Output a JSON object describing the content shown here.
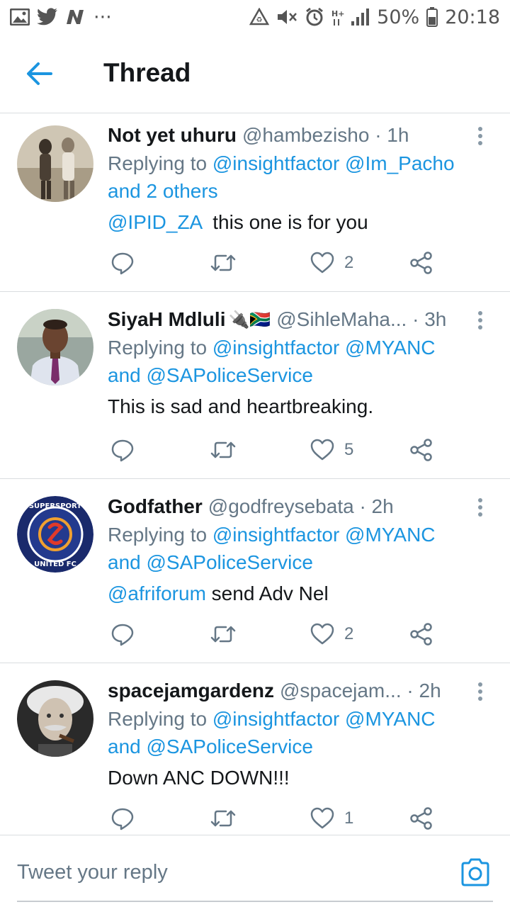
{
  "status_bar": {
    "battery": "50%",
    "time": "20:18",
    "network": "H+",
    "dots": "···"
  },
  "header": {
    "title": "Thread"
  },
  "tweets": [
    {
      "name": "Not yet uhuru",
      "handle": "@hambezisho",
      "time": "· 1h",
      "replying_prefix": "Replying to ",
      "replying_mentions": "@insightfactor @Im_Pacho",
      "replying_suffix": "and 2 others",
      "body_mention": "@IPID_ZA",
      "body_text": "  this one is for you",
      "likes": "2"
    },
    {
      "name": "SiyaH Mdluli",
      "name_emoji": "🔌🇿🇦",
      "handle": "@SihleMaha...",
      "time": "· 3h",
      "replying_prefix": "Replying to ",
      "replying_mentions": "@insightfactor @MYANC",
      "replying_suffix": "and @SAPoliceService",
      "body_mention": "",
      "body_text": "This is sad and heartbreaking.",
      "likes": "5"
    },
    {
      "name": "Godfather",
      "handle": "@godfreysebata",
      "time": "· 2h",
      "replying_prefix": "Replying to ",
      "replying_mentions": "@insightfactor @MYANC",
      "replying_suffix": "and @SAPoliceService",
      "body_mention": "@afriforum",
      "body_text": " send Adv Nel",
      "likes": "2",
      "avatar_text_top": "SUPERSPORT",
      "avatar_text_bottom": "UNITED FC"
    },
    {
      "name": "spacejamgardenz",
      "handle": "@spacejam...",
      "time": "· 2h",
      "replying_prefix": "Replying to ",
      "replying_mentions": "@insightfactor @MYANC",
      "replying_suffix": "and @SAPoliceService",
      "body_mention": "",
      "body_text": "Down ANC DOWN!!!",
      "likes": "1"
    }
  ],
  "reply_bar": {
    "placeholder": "Tweet your reply"
  },
  "colors": {
    "accent": "#1b95e0",
    "text": "#14171a",
    "muted": "#657786",
    "divider": "#d9dde0"
  },
  "icons": [
    "image-icon",
    "twitter-icon",
    "n-app-icon",
    "recycle-icon",
    "mute-icon",
    "alarm-icon",
    "signal-icon",
    "battery-icon",
    "back-arrow-icon",
    "more-vert-icon",
    "reply-icon",
    "retweet-icon",
    "heart-icon",
    "share-icon",
    "camera-icon"
  ]
}
